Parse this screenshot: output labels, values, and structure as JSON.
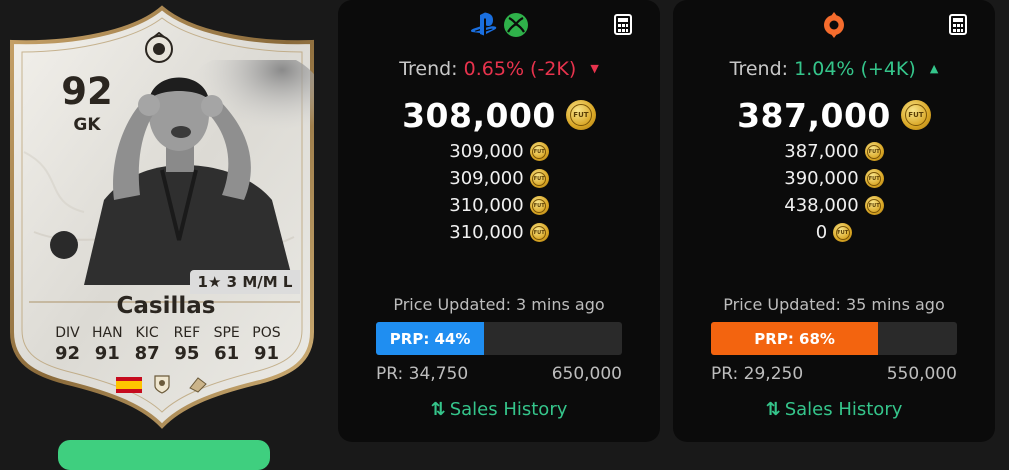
{
  "card": {
    "rating": "92",
    "position": "GK",
    "name": "Casillas",
    "traits": "1★ 3 M/M L",
    "stats": [
      {
        "label": "DIV",
        "value": "92"
      },
      {
        "label": "HAN",
        "value": "91"
      },
      {
        "label": "KIC",
        "value": "87"
      },
      {
        "label": "REF",
        "value": "95"
      },
      {
        "label": "SPE",
        "value": "61"
      },
      {
        "label": "POS",
        "value": "91"
      }
    ],
    "icons": [
      "spain-flag-icon",
      "icons-club-badge-icon",
      "icon-nation-badge-icon"
    ]
  },
  "panels": [
    {
      "platform": "console",
      "platform_icons": [
        "playstation-icon",
        "xbox-icon"
      ],
      "trend_label": "Trend:",
      "trend_value": "0.65% (-2K)",
      "trend_direction": "down",
      "trend_color": "#e8334d",
      "main_price": "308,000",
      "coin_label": "FUT",
      "prices": [
        "309,000",
        "309,000",
        "310,000",
        "310,000"
      ],
      "updated": "Price Updated: 3 mins ago",
      "prp_label": "PRP: 44%",
      "prp_percent": 44,
      "prp_color": "#1f8ef1",
      "pr_min": "PR: 34,750",
      "pr_max": "650,000",
      "sales_label": "Sales History"
    },
    {
      "platform": "pc",
      "platform_icons": [
        "origin-icon"
      ],
      "trend_label": "Trend:",
      "trend_value": "1.04% (+4K)",
      "trend_direction": "up",
      "trend_color": "#35c58b",
      "main_price": "387,000",
      "coin_label": "FUT",
      "prices": [
        "387,000",
        "390,000",
        "438,000",
        "0"
      ],
      "updated": "Price Updated: 35 mins ago",
      "prp_label": "PRP: 68%",
      "prp_percent": 68,
      "prp_color": "#f3640f",
      "pr_min": "PR: 29,250",
      "pr_max": "550,000",
      "sales_label": "Sales History"
    }
  ]
}
